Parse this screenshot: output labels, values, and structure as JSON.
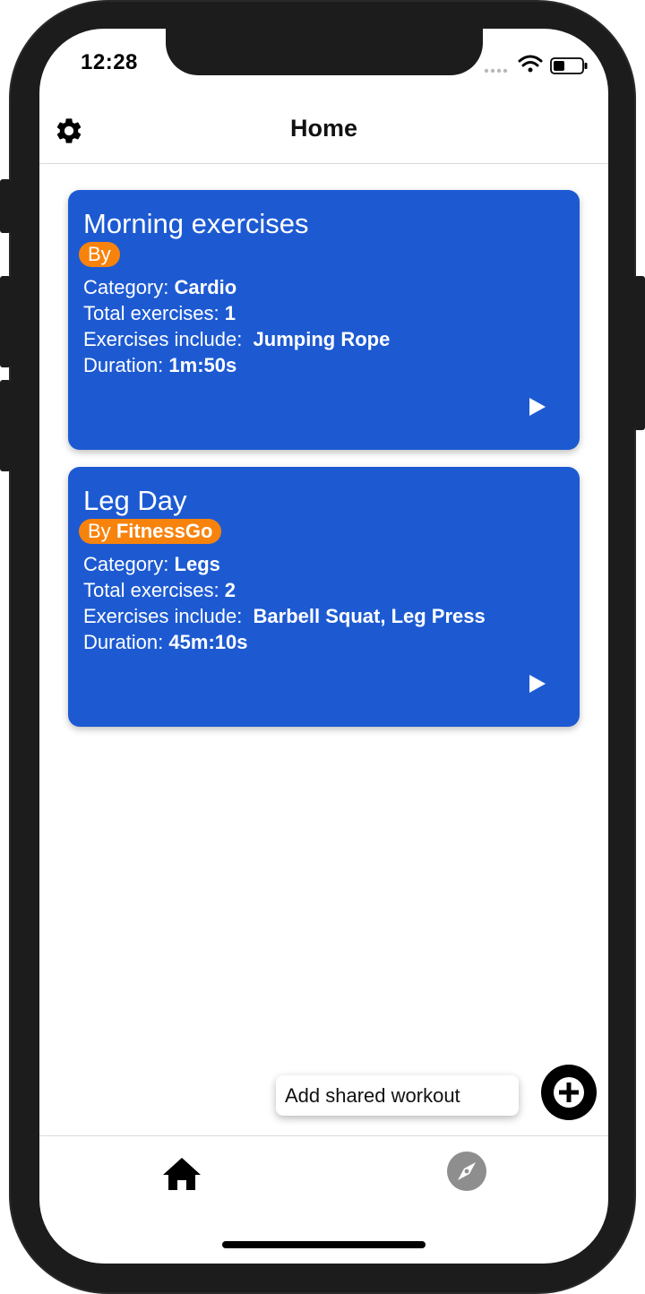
{
  "status_bar": {
    "time": "12:28"
  },
  "nav": {
    "title": "Home",
    "settings_icon": "gear-icon"
  },
  "workouts": [
    {
      "title": "Morning exercises",
      "by_prefix": "By",
      "author": "",
      "category_label": "Category:",
      "category": "Cardio",
      "total_label": "Total exercises:",
      "total": "1",
      "includes_label": "Exercises include:",
      "includes": "Jumping Rope",
      "duration_label": "Duration:",
      "duration": "1m:50s"
    },
    {
      "title": "Leg Day",
      "by_prefix": "By",
      "author": "FitnessGo",
      "category_label": "Category:",
      "category": "Legs",
      "total_label": "Total exercises:",
      "total": "2",
      "includes_label": "Exercises include:",
      "includes": "Barbell Squat, Leg Press",
      "duration_label": "Duration:",
      "duration": "45m:10s"
    }
  ],
  "fab": {
    "tooltip": "Add shared workout",
    "icon": "plus-icon"
  },
  "tabs": [
    {
      "icon": "home-icon",
      "active": true
    },
    {
      "icon": "compass-icon",
      "active": false
    }
  ],
  "colors": {
    "card": "#1d5ad2",
    "badge": "#f7830d",
    "fab": "#000000",
    "tab_inactive": "#8e8e8e"
  }
}
